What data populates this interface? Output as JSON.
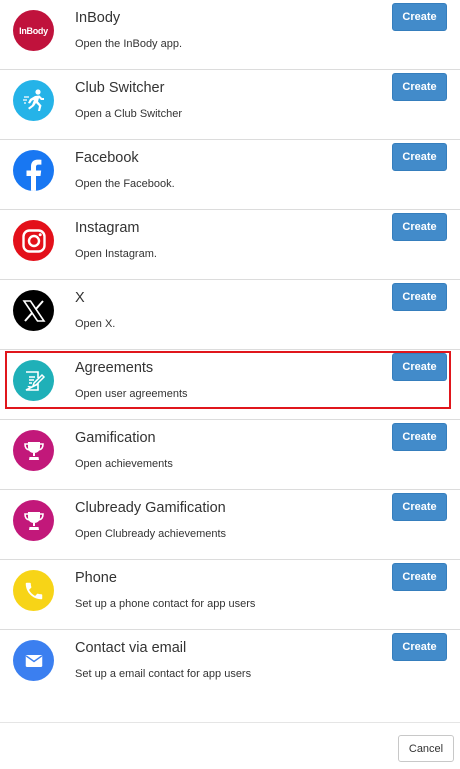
{
  "button_label": "Create",
  "items": [
    {
      "title": "InBody",
      "description": "Open the InBody app.",
      "icon": "inbody-logo-icon",
      "icon_text": "InBody",
      "color": "#c0123c"
    },
    {
      "title": "Club Switcher",
      "description": "Open a Club Switcher",
      "icon": "running-person-icon",
      "color": "#25b3e8"
    },
    {
      "title": "Facebook",
      "description": "Open the Facebook.",
      "icon": "facebook-icon",
      "color": "#1877f2"
    },
    {
      "title": "Instagram",
      "description": "Open Instagram.",
      "icon": "instagram-icon",
      "color": "#e3101a"
    },
    {
      "title": "X",
      "description": "Open X.",
      "icon": "x-logo-icon",
      "color": "#000000"
    },
    {
      "title": "Agreements",
      "description": "Open user agreements",
      "icon": "document-sign-icon",
      "color": "#1fb0b8",
      "highlighted": true
    },
    {
      "title": "Gamification",
      "description": "Open achievements",
      "icon": "trophy-icon",
      "color": "#c2187a"
    },
    {
      "title": "Clubready Gamification",
      "description": "Open Clubready achievements",
      "icon": "trophy-icon",
      "color": "#c2187a"
    },
    {
      "title": "Phone",
      "description": "Set up a phone contact for app users",
      "icon": "phone-icon",
      "color": "#f7d417"
    },
    {
      "title": "Contact via email",
      "description": "Set up a email contact for app users",
      "icon": "envelope-icon",
      "color": "#3b7ff0"
    }
  ],
  "footer": {
    "cancel_label": "Cancel"
  }
}
